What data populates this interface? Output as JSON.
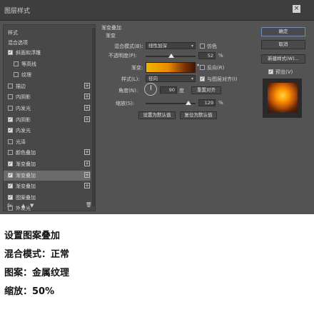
{
  "window": {
    "title": "图层样式",
    "close_glyph": "×"
  },
  "left_panel": {
    "header": "样式",
    "blend_options": "混合选项",
    "items": [
      {
        "label": "斜面和浮雕",
        "checked": true,
        "plus": false,
        "indent": false
      },
      {
        "label": "等高线",
        "checked": false,
        "plus": false,
        "indent": true
      },
      {
        "label": "纹理",
        "checked": false,
        "plus": false,
        "indent": true
      },
      {
        "label": "描边",
        "checked": false,
        "plus": true,
        "indent": false
      },
      {
        "label": "内阴影",
        "checked": false,
        "plus": true,
        "indent": false
      },
      {
        "label": "内发光",
        "checked": false,
        "plus": true,
        "indent": false
      },
      {
        "label": "内阴影",
        "checked": true,
        "plus": true,
        "indent": false
      },
      {
        "label": "内发光",
        "checked": true,
        "plus": false,
        "indent": false
      },
      {
        "label": "光泽",
        "checked": false,
        "plus": false,
        "indent": false
      },
      {
        "label": "颜色叠加",
        "checked": false,
        "plus": true,
        "indent": false
      },
      {
        "label": "渐变叠加",
        "checked": true,
        "plus": true,
        "indent": false
      },
      {
        "label": "渐变叠加",
        "checked": true,
        "plus": true,
        "indent": false,
        "active": true
      },
      {
        "label": "渐变叠加",
        "checked": true,
        "plus": true,
        "indent": false
      },
      {
        "label": "图案叠加",
        "checked": true,
        "plus": false,
        "indent": false
      },
      {
        "label": "外发光",
        "checked": false,
        "plus": false,
        "indent": false
      }
    ],
    "footer": {
      "fx": "fx",
      "up": "▲",
      "down": "▼",
      "trash": "🗑"
    }
  },
  "main": {
    "section_title": "渐变叠加",
    "group_title": "渐变",
    "blend_mode_label": "混合模式(B):",
    "blend_mode_value": "线性加深",
    "dither_label": "仿色",
    "opacity_label": "不透明度(P):",
    "opacity_value": "52",
    "opacity_unit": "%",
    "opacity_level": 0.52,
    "gradient_label": "渐变:",
    "reverse_label": "反向(R)",
    "style_label": "样式(L):",
    "style_value": "径向",
    "align_label": "与图层对齐(I)",
    "angle_label": "角度(N):",
    "angle_value": "90",
    "angle_unit": "度",
    "reset_align_button": "重置对齐",
    "scale_label": "缩放(S):",
    "scale_value": "129",
    "scale_unit": "%",
    "scale_level": 0.86,
    "set_default_button": "设置为默认值",
    "reset_default_button": "复位为默认值"
  },
  "right_panel": {
    "ok_button": "确定",
    "cancel_button": "取消",
    "new_style_button": "新建样式(W)...",
    "preview_label": "预览(V)",
    "preview_checked": true
  },
  "caption": {
    "line1": "设置图案叠加",
    "line2": "混合模式：正常",
    "line3": "图案：金属纹理",
    "line4": "缩放：50%"
  }
}
